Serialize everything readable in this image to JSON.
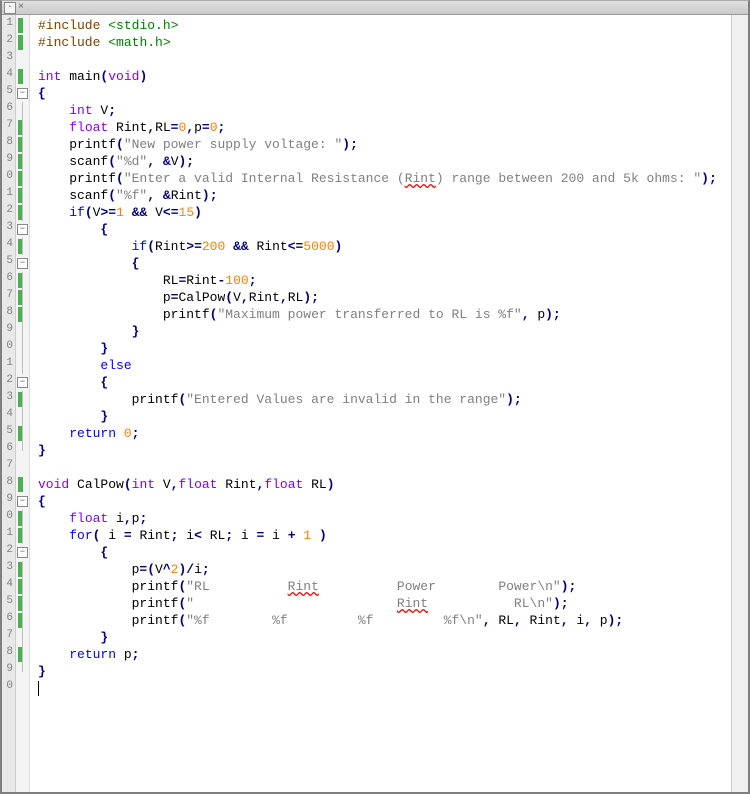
{
  "tab": {
    "close": "×"
  },
  "lines": [
    {
      "num": "1",
      "chg": true,
      "fold": null,
      "html": "<span class='pre'>#include</span> <span class='inc'>&lt;stdio.h&gt;</span>"
    },
    {
      "num": "2",
      "chg": true,
      "fold": null,
      "html": "<span class='pre'>#include</span> <span class='inc'>&lt;math.h&gt;</span>"
    },
    {
      "num": "3",
      "chg": false,
      "fold": null,
      "html": ""
    },
    {
      "num": "4",
      "chg": true,
      "fold": null,
      "html": "<span class='typ'>int</span> main<span class='op'>(</span><span class='typ'>void</span><span class='op'>)</span>"
    },
    {
      "num": "5",
      "chg": false,
      "fold": "⊟",
      "html": "<span class='op'>{</span>"
    },
    {
      "num": "6",
      "chg": false,
      "fold": "|",
      "html": "    <span class='typ'>int</span> V<span class='op'>;</span>"
    },
    {
      "num": "7",
      "chg": true,
      "fold": "|",
      "html": "    <span class='typ'>float</span> Rint<span class='op'>,</span>RL<span class='op'>=</span><span class='num'>0</span><span class='op'>,</span>p<span class='op'>=</span><span class='num'>0</span><span class='op'>;</span>"
    },
    {
      "num": "8",
      "chg": true,
      "fold": "|",
      "html": "    printf<span class='op'>(</span><span class='str'>\"New power supply voltage: \"</span><span class='op'>);</span>"
    },
    {
      "num": "9",
      "chg": true,
      "fold": "|",
      "html": "    scanf<span class='op'>(</span><span class='str'>\"%d\"</span><span class='op'>,</span> <span class='op'>&amp;</span>V<span class='op'>);</span>"
    },
    {
      "num": "0",
      "chg": true,
      "fold": "|",
      "html": "    printf<span class='op'>(</span><span class='str'>\"Enter a valid Internal Resistance (<span class='wavy'>Rint</span>) range between 200 and 5k ohms: \"</span><span class='op'>);</span>"
    },
    {
      "num": "1",
      "chg": true,
      "fold": "|",
      "html": "    scanf<span class='op'>(</span><span class='str'>\"%f\"</span><span class='op'>,</span> <span class='op'>&amp;</span>Rint<span class='op'>);</span>"
    },
    {
      "num": "2",
      "chg": true,
      "fold": "|",
      "html": "    <span class='kw'>if</span><span class='op'>(</span>V<span class='op'>&gt;=</span><span class='num'>1</span> <span class='op'>&amp;&amp;</span> V<span class='op'>&lt;=</span><span class='num'>15</span><span class='op'>)</span>"
    },
    {
      "num": "3",
      "chg": false,
      "fold": "⊟",
      "html": "        <span class='op'>{</span>"
    },
    {
      "num": "4",
      "chg": true,
      "fold": "|",
      "html": "            <span class='kw'>if</span><span class='op'>(</span>Rint<span class='op'>&gt;=</span><span class='num'>200</span> <span class='op'>&amp;&amp;</span> Rint<span class='op'>&lt;=</span><span class='num'>5000</span><span class='op'>)</span>"
    },
    {
      "num": "5",
      "chg": false,
      "fold": "⊟",
      "html": "            <span class='op'>{</span>"
    },
    {
      "num": "6",
      "chg": true,
      "fold": "|",
      "html": "                RL<span class='op'>=</span>Rint<span class='op'>-</span><span class='num'>100</span><span class='op'>;</span>"
    },
    {
      "num": "7",
      "chg": true,
      "fold": "|",
      "html": "                p<span class='op'>=</span>CalPow<span class='op'>(</span>V<span class='op'>,</span>Rint<span class='op'>,</span>RL<span class='op'>);</span>"
    },
    {
      "num": "8",
      "chg": true,
      "fold": "|",
      "html": "                printf<span class='op'>(</span><span class='str'>\"Maximum power transferred to RL is %f\"</span><span class='op'>,</span> p<span class='op'>);</span>"
    },
    {
      "num": "9",
      "chg": false,
      "fold": "|",
      "html": "            <span class='op'>}</span>"
    },
    {
      "num": "0",
      "chg": false,
      "fold": "|",
      "html": "        <span class='op'>}</span>"
    },
    {
      "num": "1",
      "chg": false,
      "fold": "|",
      "html": "        <span class='kw'>else</span>"
    },
    {
      "num": "2",
      "chg": false,
      "fold": "⊟",
      "html": "        <span class='op'>{</span>"
    },
    {
      "num": "3",
      "chg": true,
      "fold": "|",
      "html": "            printf<span class='op'>(</span><span class='str'>\"Entered Values are invalid in the range\"</span><span class='op'>);</span>"
    },
    {
      "num": "4",
      "chg": false,
      "fold": "|",
      "html": "        <span class='op'>}</span>"
    },
    {
      "num": "5",
      "chg": true,
      "fold": "|",
      "html": "    <span class='kw'>return</span> <span class='num'>0</span><span class='op'>;</span>"
    },
    {
      "num": "6",
      "chg": false,
      "fold": "└",
      "html": "<span class='op'>}</span>"
    },
    {
      "num": "7",
      "chg": false,
      "fold": null,
      "html": ""
    },
    {
      "num": "8",
      "chg": true,
      "fold": null,
      "html": "<span class='typ'>void</span> CalPow<span class='op'>(</span><span class='typ'>int</span> V<span class='op'>,</span><span class='typ'>float</span> Rint<span class='op'>,</span><span class='typ'>float</span> RL<span class='op'>)</span>"
    },
    {
      "num": "9",
      "chg": false,
      "fold": "⊟",
      "html": "<span class='op'>{</span>"
    },
    {
      "num": "0",
      "chg": true,
      "fold": "|",
      "html": "    <span class='typ'>float</span> i<span class='op'>,</span>p<span class='op'>;</span>"
    },
    {
      "num": "1",
      "chg": true,
      "fold": "|",
      "html": "    <span class='kw'>for</span><span class='op'>(</span> i <span class='op'>=</span> Rint<span class='op'>;</span> i<span class='op'>&lt;</span> RL<span class='op'>;</span> i <span class='op'>=</span> i <span class='op'>+</span> <span class='num'>1</span> <span class='op'>)</span>"
    },
    {
      "num": "2",
      "chg": false,
      "fold": "⊟",
      "html": "        <span class='op'>{</span>"
    },
    {
      "num": "3",
      "chg": true,
      "fold": "|",
      "html": "            p<span class='op'>=(</span>V<span class='op'>^</span><span class='num'>2</span><span class='op'>)/</span>i<span class='op'>;</span>"
    },
    {
      "num": "4",
      "chg": true,
      "fold": "|",
      "html": "            printf<span class='op'>(</span><span class='str'>\"RL          <span class='wavy'>Rint</span>          Power        Power\\n\"</span><span class='op'>);</span>"
    },
    {
      "num": "5",
      "chg": true,
      "fold": "|",
      "html": "            printf<span class='op'>(</span><span class='str'>\"                          <span class='wavy'>Rint</span>           RL\\n\"</span><span class='op'>);</span>"
    },
    {
      "num": "6",
      "chg": true,
      "fold": "|",
      "html": "            printf<span class='op'>(</span><span class='str'>\"%f        %f         %f         %f\\n\"</span><span class='op'>,</span> RL<span class='op'>,</span> Rint<span class='op'>,</span> i<span class='op'>,</span> p<span class='op'>);</span>"
    },
    {
      "num": "7",
      "chg": false,
      "fold": "|",
      "html": "        <span class='op'>}</span>"
    },
    {
      "num": "8",
      "chg": true,
      "fold": "|",
      "html": "    <span class='kw'>return</span> p<span class='op'>;</span>"
    },
    {
      "num": "9",
      "chg": false,
      "fold": "└",
      "html": "<span class='op'>}</span>"
    },
    {
      "num": "0",
      "chg": false,
      "fold": null,
      "html": "<span class='cursor-caret'></span>"
    }
  ]
}
